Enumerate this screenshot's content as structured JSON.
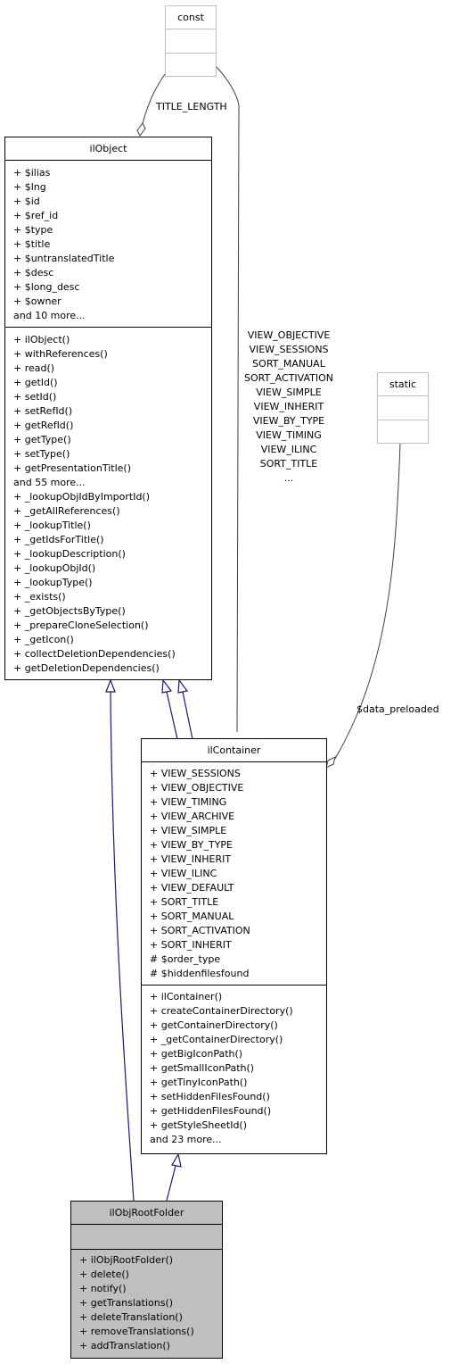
{
  "classes": {
    "const": {
      "name": "const"
    },
    "static": {
      "name": "static"
    },
    "ilObject": {
      "name": "ilObject",
      "attributes": [
        "+ $ilias",
        "+ $lng",
        "+ $id",
        "+ $ref_id",
        "+ $type",
        "+ $title",
        "+ $untranslatedTitle",
        "+ $desc",
        "+ $long_desc",
        "+ $owner",
        "and 10 more..."
      ],
      "methods": [
        "+ ilObject()",
        "+ withReferences()",
        "+ read()",
        "+ getId()",
        "+ setId()",
        "+ setRefId()",
        "+ getRefId()",
        "+ getType()",
        "+ setType()",
        "+ getPresentationTitle()",
        "and 55 more...",
        "+ _lookupObjIdByImportId()",
        "+ _getAllReferences()",
        "+ _lookupTitle()",
        "+ _getIdsForTitle()",
        "+ _lookupDescription()",
        "+ _lookupObjId()",
        "+ _lookupType()",
        "+ _exists()",
        "+ _getObjectsByType()",
        "+ _prepareCloneSelection()",
        "+ _getIcon()",
        "+ collectDeletionDependencies()",
        "+ getDeletionDependencies()"
      ]
    },
    "ilContainer": {
      "name": "ilContainer",
      "attributes": [
        "+ VIEW_SESSIONS",
        "+ VIEW_OBJECTIVE",
        "+ VIEW_TIMING",
        "+ VIEW_ARCHIVE",
        "+ VIEW_SIMPLE",
        "+ VIEW_BY_TYPE",
        "+ VIEW_INHERIT",
        "+ VIEW_ILINC",
        "+ VIEW_DEFAULT",
        "+ SORT_TITLE",
        "+ SORT_MANUAL",
        "+ SORT_ACTIVATION",
        "+ SORT_INHERIT",
        "# $order_type",
        "# $hiddenfilesfound"
      ],
      "methods": [
        "+ ilContainer()",
        "+ createContainerDirectory()",
        "+ getContainerDirectory()",
        "+ _getContainerDirectory()",
        "+ getBigIconPath()",
        "+ getSmallIconPath()",
        "+ getTinyIconPath()",
        "+ setHiddenFilesFound()",
        "+ getHiddenFilesFound()",
        "+ getStyleSheetId()",
        "and 23 more..."
      ]
    },
    "ilObjRootFolder": {
      "name": "ilObjRootFolder",
      "attributes": [],
      "methods": [
        "+ ilObjRootFolder()",
        "+ delete()",
        "+ notify()",
        "+ getTranslations()",
        "+ deleteTranslation()",
        "+ removeTranslations()",
        "+ addTranslation()"
      ]
    }
  },
  "edge_labels": {
    "title_length": "TITLE_LENGTH",
    "container_consts": [
      "VIEW_OBJECTIVE",
      "VIEW_SESSIONS",
      "SORT_MANUAL",
      "SORT_ACTIVATION",
      "VIEW_SIMPLE",
      "VIEW_INHERIT",
      "VIEW_BY_TYPE",
      "VIEW_TIMING",
      "VIEW_ILINC",
      "SORT_TITLE",
      "..."
    ],
    "data_preloaded": "$data_preloaded"
  },
  "colors": {
    "inheritance": "#191970",
    "association": "#404040",
    "selected_fill": "#bfbfbf",
    "grey_border": "#bfbfbf"
  }
}
